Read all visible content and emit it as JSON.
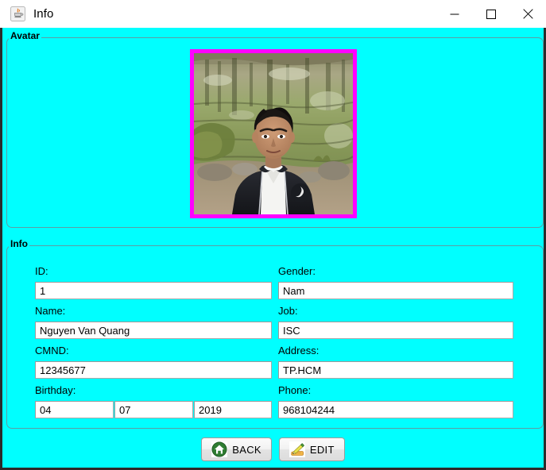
{
  "window": {
    "title": "Info",
    "app_icon": "java-cup-icon",
    "controls": {
      "minimize": "minimize-icon",
      "maximize": "maximize-icon",
      "close": "close-icon"
    },
    "background_color": "#00ffff"
  },
  "avatar_panel": {
    "title": "Avatar",
    "photo": {
      "name": "avatar-photo",
      "border_color": "#ff00ff",
      "description": "Portrait photo of a young man in a dark jacket and white shirt in front of a pond"
    }
  },
  "info_panel": {
    "title": "Info",
    "fields": {
      "id": {
        "label": "ID:",
        "value": "1"
      },
      "gender": {
        "label": "Gender:",
        "value": "Nam"
      },
      "name": {
        "label": "Name:",
        "value": "Nguyen Van Quang"
      },
      "job": {
        "label": "Job:",
        "value": "ISC"
      },
      "cmnd": {
        "label": "CMND:",
        "value": "12345677"
      },
      "address": {
        "label": "Address:",
        "value": "TP.HCM"
      },
      "birthday": {
        "label": "Birthday:",
        "day": "04",
        "month": "07",
        "year": "2019"
      },
      "phone": {
        "label": "Phone:",
        "value": "968104244"
      }
    }
  },
  "buttons": {
    "back": {
      "label": "BACK",
      "icon": "home-icon"
    },
    "edit": {
      "label": "EDIT",
      "icon": "pencil-edit-icon"
    }
  }
}
